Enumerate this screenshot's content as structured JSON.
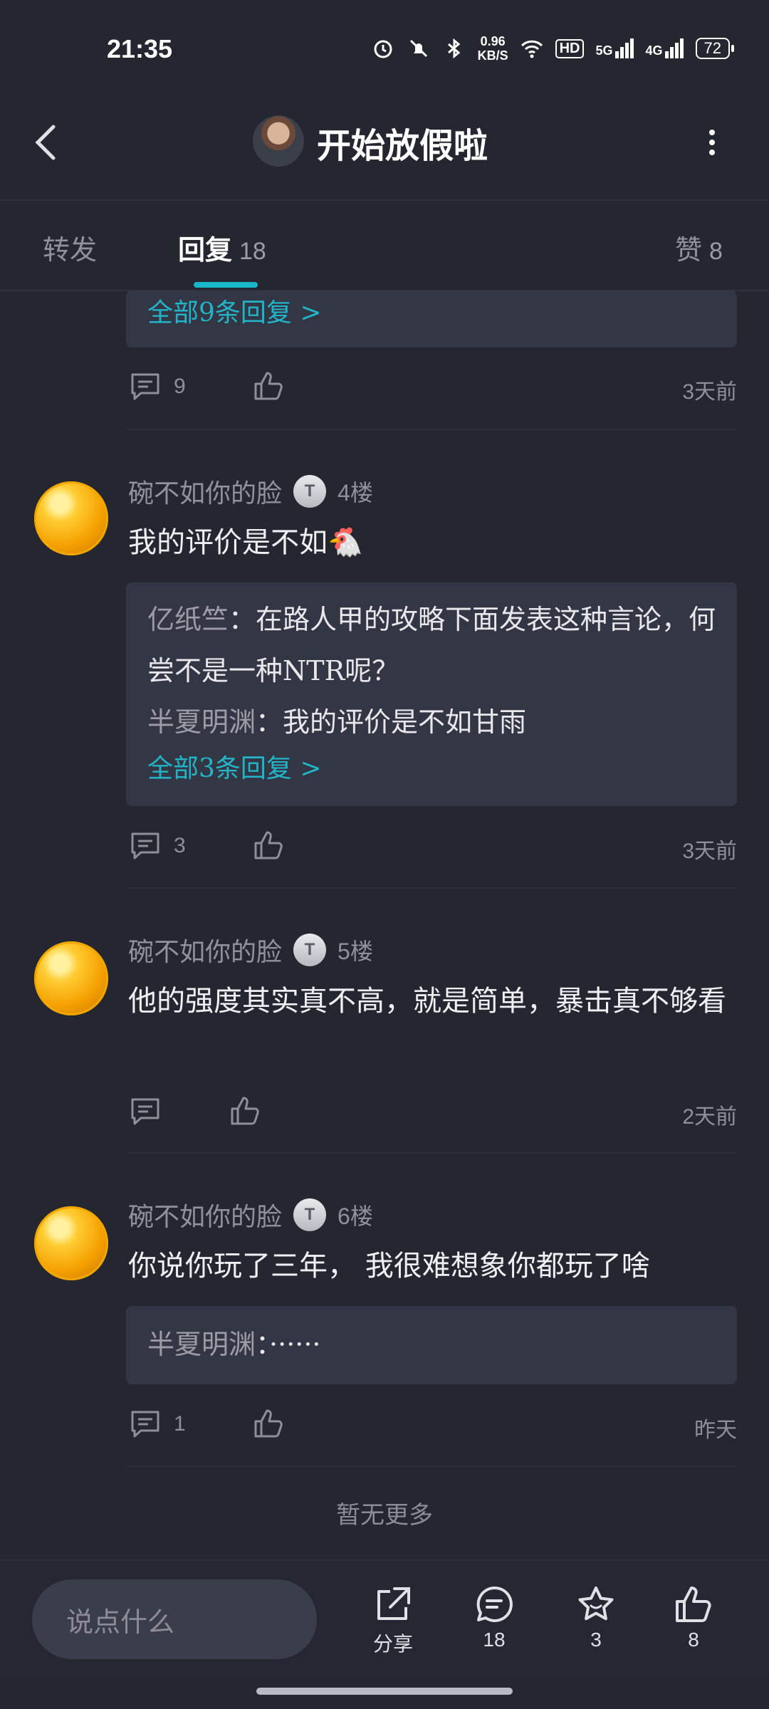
{
  "status": {
    "time": "21:35",
    "netspeed_value": "0.96",
    "netspeed_unit": "KB/S",
    "signal1": "5G",
    "signal2": "4G",
    "hd_label": "HD",
    "battery": "72"
  },
  "header": {
    "title": "开始放假啦"
  },
  "tabs": {
    "forward": "转发",
    "reply": "回复",
    "reply_count": "18",
    "like": "赞",
    "like_count": "8"
  },
  "prev_post": {
    "all_replies_link": "全部9条回复 >",
    "comment_count": "9",
    "time": "3天前"
  },
  "posts": [
    {
      "username": "碗不如你的脸",
      "badge": "T",
      "floor": "4楼",
      "text": "我的评价是不如🐔",
      "quotes": [
        {
          "name": "亿纸竺",
          "sep": "：",
          "text": "在路人甲的攻略下面发表这种言论，何尝不是一种NTR呢？"
        },
        {
          "name": "半夏明渊",
          "sep": "：",
          "text": "我的评价是不如甘雨"
        }
      ],
      "all_replies_link": "全部3条回复 >",
      "comment_count": "3",
      "time": "3天前"
    },
    {
      "username": "碗不如你的脸",
      "badge": "T",
      "floor": "5楼",
      "text": "他的强度其实真不高，就是简单，暴击真不够看",
      "comment_count": "",
      "time": "2天前"
    },
    {
      "username": "碗不如你的脸",
      "badge": "T",
      "floor": "6楼",
      "text": "你说你玩了三年， 我很难想象你都玩了啥",
      "quotes": [
        {
          "name": "半夏明渊",
          "sep": "：",
          "text": "······"
        }
      ],
      "comment_count": "1",
      "time": "昨天"
    }
  ],
  "footer": {
    "no_more": "暂无更多",
    "input_placeholder": "说点什么",
    "share_label": "分享",
    "comments_count": "18",
    "favorites_count": "3",
    "likes_count": "8"
  },
  "colors": {
    "background": "#242630",
    "accent": "#18b6c9",
    "quote_box": "#333644"
  }
}
